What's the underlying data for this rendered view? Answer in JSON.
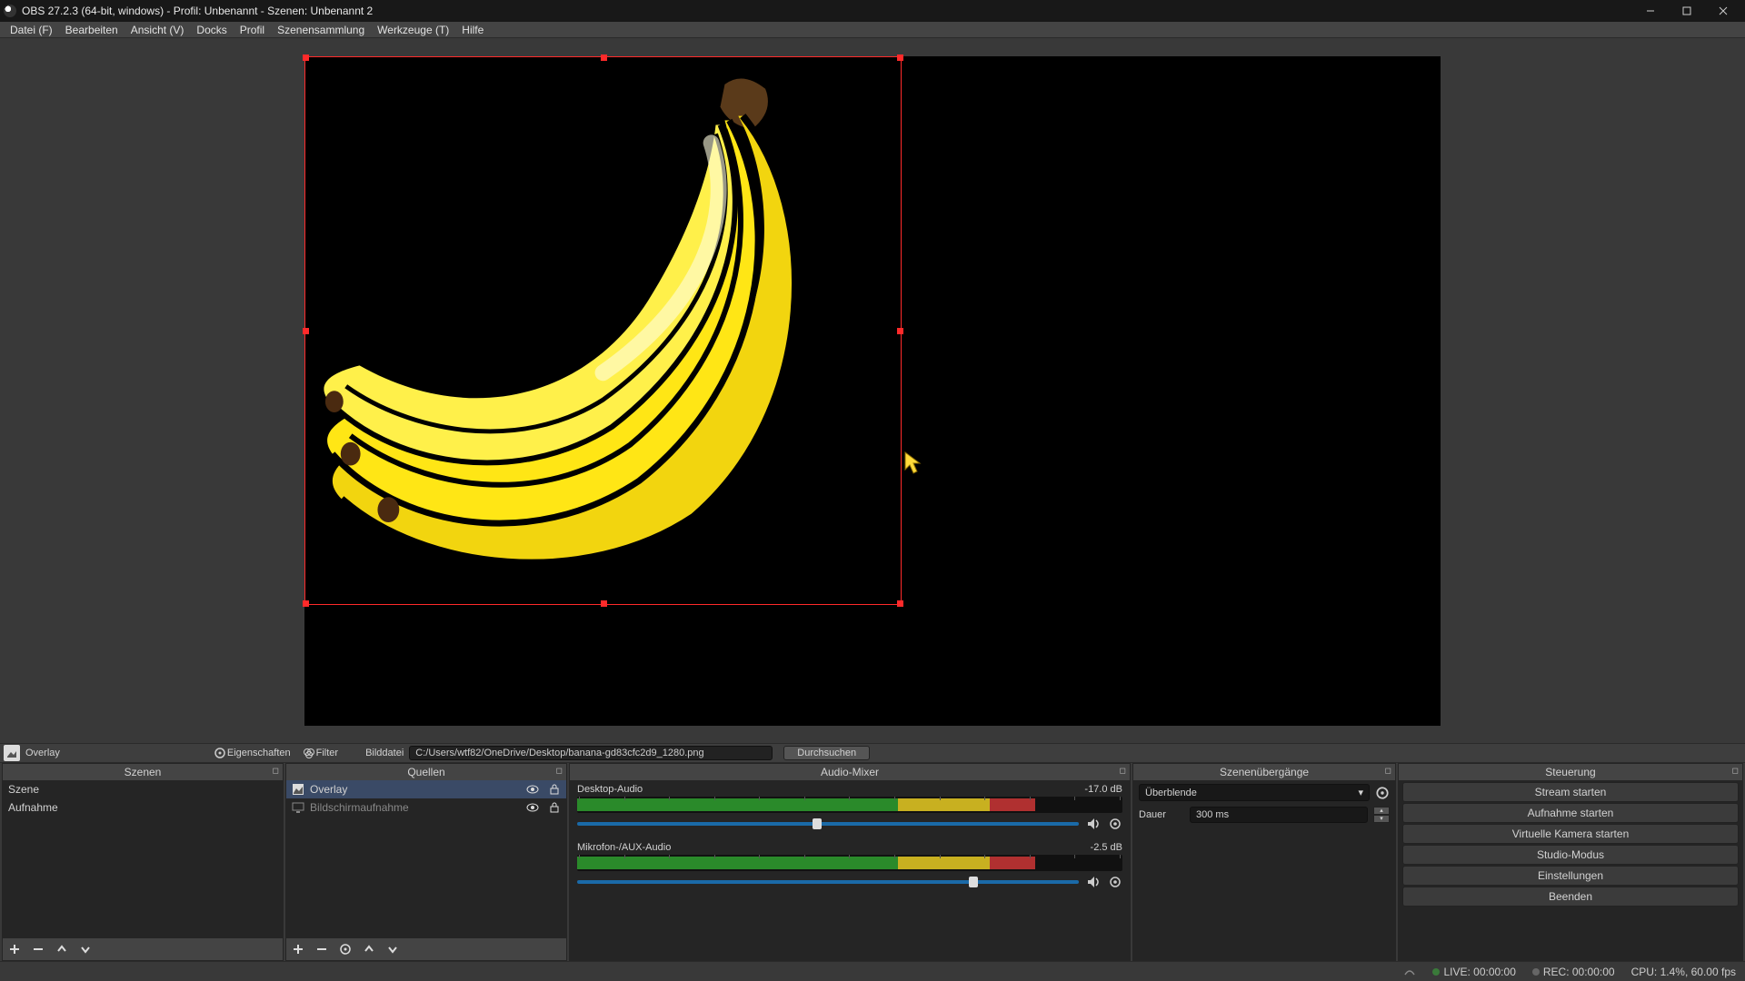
{
  "window": {
    "title": "OBS 27.2.3 (64-bit, windows) - Profil: Unbenannt - Szenen: Unbenannt 2"
  },
  "menubar": [
    "Datei (F)",
    "Bearbeiten",
    "Ansicht (V)",
    "Docks",
    "Profil",
    "Szenensammlung",
    "Werkzeuge (T)",
    "Hilfe"
  ],
  "source_toolbar": {
    "name": "Overlay",
    "properties": "Eigenschaften",
    "filters": "Filter",
    "path_label": "Bilddatei",
    "path_value": "C:/Users/wtf82/OneDrive/Desktop/banana-gd83cfc2d9_1280.png",
    "browse": "Durchsuchen"
  },
  "scenes": {
    "title": "Szenen",
    "items": [
      "Szene",
      "Aufnahme"
    ]
  },
  "sources": {
    "title": "Quellen",
    "items": [
      {
        "name": "Overlay",
        "icon": "image",
        "selected": true,
        "locked": false
      },
      {
        "name": "Bildschirmaufnahme",
        "icon": "monitor",
        "selected": false,
        "locked": false
      }
    ]
  },
  "mixer": {
    "title": "Audio-Mixer",
    "channels": [
      {
        "name": "Desktop-Audio",
        "level_db": "-17.0 dB",
        "meter_pct": 84,
        "slider_pct": 47
      },
      {
        "name": "Mikrofon-/AUX-Audio",
        "level_db": "-2.5 dB",
        "meter_pct": 84,
        "slider_pct": 78
      }
    ]
  },
  "transitions": {
    "title": "Szenenübergänge",
    "selected": "Überblende",
    "duration_label": "Dauer",
    "duration_value": "300 ms"
  },
  "controls": {
    "title": "Steuerung",
    "buttons": [
      "Stream starten",
      "Aufnahme starten",
      "Virtuelle Kamera starten",
      "Studio-Modus",
      "Einstellungen",
      "Beenden"
    ]
  },
  "status": {
    "live": "LIVE: 00:00:00",
    "rec": "REC: 00:00:00",
    "cpu": "CPU: 1.4%, 60.00 fps"
  }
}
